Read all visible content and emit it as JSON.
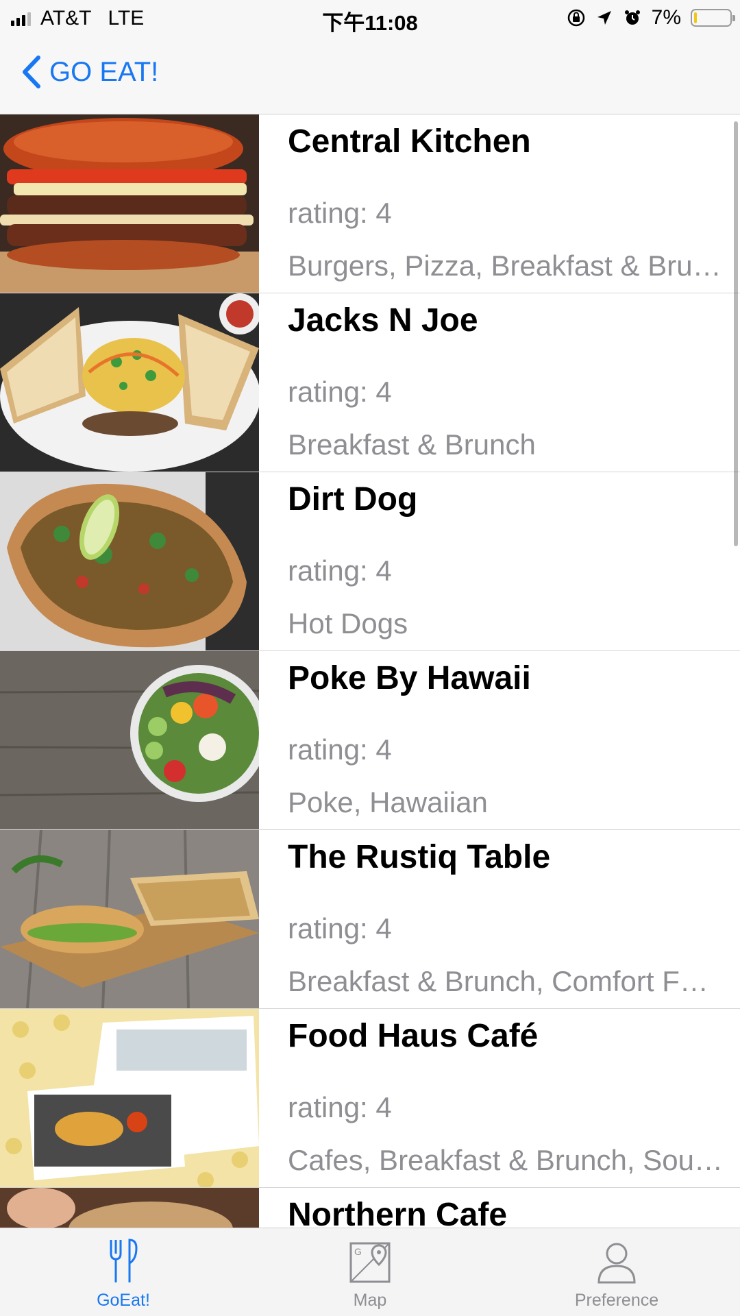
{
  "status_bar": {
    "carrier": "AT&T",
    "network": "LTE",
    "time": "下午11:08",
    "battery_percent": "7%",
    "battery_level": 0.07
  },
  "nav": {
    "back_label": "GO EAT!"
  },
  "restaurants": [
    {
      "name": "Central Kitchen",
      "rating": "rating: 4",
      "categories": "Burgers, Pizza, Breakfast & Bru…"
    },
    {
      "name": "Jacks N Joe",
      "rating": "rating: 4",
      "categories": "Breakfast & Brunch"
    },
    {
      "name": "Dirt Dog",
      "rating": "rating: 4",
      "categories": "Hot Dogs"
    },
    {
      "name": "Poke By Hawaii",
      "rating": "rating: 4",
      "categories": "Poke, Hawaiian"
    },
    {
      "name": "The Rustiq Table",
      "rating": "rating: 4",
      "categories": "Breakfast & Brunch, Comfort F…"
    },
    {
      "name": "Food Haus Café",
      "rating": "rating: 4",
      "categories": "Cafes, Breakfast & Brunch, Sou…"
    },
    {
      "name": "Northern Cafe",
      "rating": "",
      "categories": ""
    }
  ],
  "tabs": [
    {
      "label": "GoEat!",
      "icon": "fork-knife-icon",
      "active": true
    },
    {
      "label": "Map",
      "icon": "map-icon",
      "active": false
    },
    {
      "label": "Preference",
      "icon": "person-icon",
      "active": false
    }
  ],
  "colors": {
    "accent": "#1877f2",
    "secondary_text": "#8e8e93",
    "battery_low": "#f0c81c"
  }
}
